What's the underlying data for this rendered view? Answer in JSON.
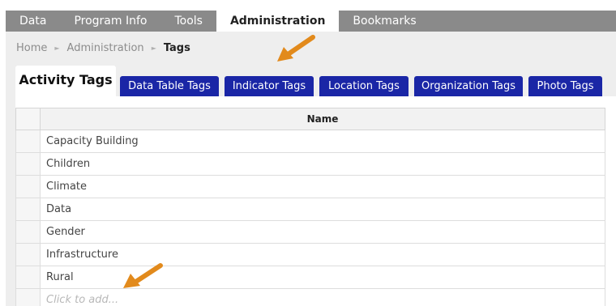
{
  "topnav": {
    "items": [
      {
        "label": "Data",
        "active": false
      },
      {
        "label": "Program Info",
        "active": false
      },
      {
        "label": "Tools",
        "active": false
      },
      {
        "label": "Administration",
        "active": true
      },
      {
        "label": "Bookmarks",
        "active": false
      }
    ]
  },
  "breadcrumb": {
    "home": "Home",
    "section": "Administration",
    "current": "Tags"
  },
  "tabs": [
    {
      "label": "Activity Tags",
      "active": true
    },
    {
      "label": "Data Table Tags",
      "active": false
    },
    {
      "label": "Indicator Tags",
      "active": false
    },
    {
      "label": "Location Tags",
      "active": false
    },
    {
      "label": "Organization Tags",
      "active": false
    },
    {
      "label": "Photo Tags",
      "active": false
    }
  ],
  "table": {
    "header": "Name",
    "rows": [
      "Capacity Building",
      "Children",
      "Climate",
      "Data",
      "Gender",
      "Infrastructure",
      "Rural"
    ],
    "add_placeholder": "Click to add..."
  },
  "colors": {
    "nav_bg": "#8a8a8a",
    "tab_blue": "#1a26a6",
    "callout_arrow": "#e28a1c"
  },
  "annotations": {
    "arrow_icon": "orange-callout-arrow-icon"
  }
}
